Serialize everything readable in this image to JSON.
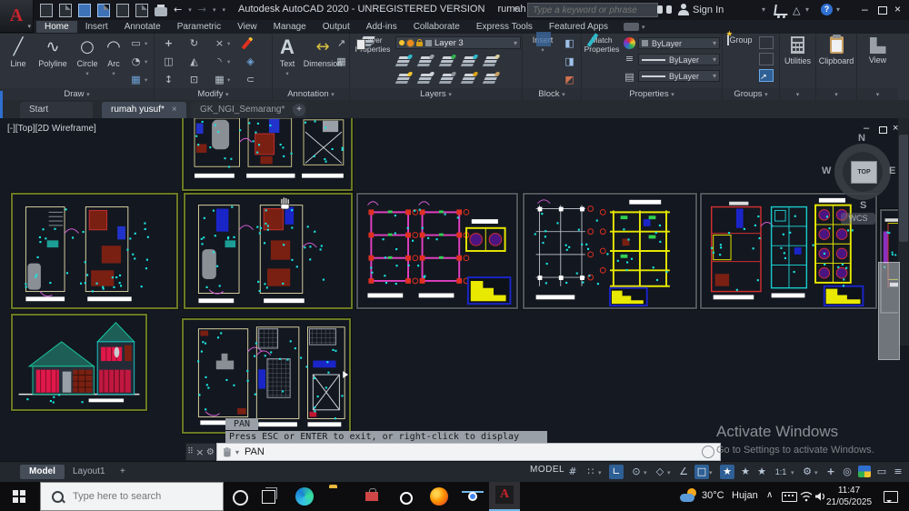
{
  "titlebar": {
    "app_title": "Autodesk AutoCAD 2020 - UNREGISTERED VERSION",
    "doc_title": "rumah yusuf.dwg",
    "search_placeholder": "Type a keyword or phrase",
    "sign_in": "Sign In",
    "adsk_glyph": "△"
  },
  "ribbon": {
    "tabs": [
      "Home",
      "Insert",
      "Annotate",
      "Parametric",
      "View",
      "Manage",
      "Output",
      "Add-ins",
      "Collaborate",
      "Express Tools",
      "Featured Apps"
    ],
    "panels": {
      "draw": {
        "label": "Draw",
        "line": "Line",
        "polyline": "Polyline",
        "circle": "Circle",
        "arc": "Arc"
      },
      "modify": {
        "label": "Modify"
      },
      "annotation": {
        "label": "Annotation",
        "text": "Text",
        "dimension": "Dimension"
      },
      "layers": {
        "label": "Layers",
        "layer_properties": "Layer Properties",
        "current_layer": "Layer 3"
      },
      "block": {
        "label": "Block",
        "insert": "Insert"
      },
      "properties": {
        "label": "Properties",
        "match_properties": "Match Properties",
        "color": "ByLayer",
        "lineweight": "ByLayer",
        "linetype": "ByLayer"
      },
      "groups": {
        "label": "Groups",
        "group": "Group"
      },
      "utilities": {
        "label": "Utilities"
      },
      "clipboard": {
        "label": "Clipboard"
      },
      "view": {
        "label": "View"
      }
    }
  },
  "file_tabs": {
    "start": "Start",
    "tab1": "rumah yusuf*",
    "tab2": "GK_NGI_Semarang*",
    "close": "×",
    "add": "+"
  },
  "canvas": {
    "viewport_label": "[-][Top][2D Wireframe]",
    "viewcube": {
      "n": "N",
      "s": "S",
      "e": "E",
      "w": "W",
      "top": "TOP",
      "wcs": "WCS"
    },
    "pan_tooltip": "PAN",
    "prompt": "Press ESC or ENTER to exit, or right-click to display shortcut menu.",
    "command": "PAN",
    "watermark": {
      "line1": "Activate Windows",
      "line2": "Go to Settings to activate Windows."
    }
  },
  "statusbar": {
    "model_tab": "Model",
    "layout_tab": "Layout1",
    "add_layout": "+",
    "model_badge": "MODEL",
    "annotation_scale": "1:1"
  },
  "taskbar": {
    "search_placeholder": "Type here to search",
    "autocad_letter": "A",
    "weather_temp": "30°C",
    "weather_desc": "Hujan",
    "time": "11:47",
    "date": "21/05/2025"
  },
  "icons": {
    "dropdown": "▾",
    "flyout": "▸",
    "minimize": "–",
    "close": "×",
    "undo": "←",
    "redo": "→",
    "line": "╱",
    "polyline": "∿",
    "circle": "○",
    "arc": "◠",
    "rectangle": "▭",
    "ellipse": "◔",
    "hatch": "▦",
    "move": "+",
    "rotate": "↻",
    "trim": "×",
    "copy": "◫",
    "mirror": "◭",
    "fillet": "◝",
    "explode": "◈",
    "stretch": "↕",
    "scale": "⊡",
    "array": "▦",
    "offset": "⊂",
    "text_glyph": "A",
    "dimension": "↔",
    "leader": "↗",
    "table": "▦",
    "lines3": "≡",
    "hatchrow": "▤",
    "grip": "⠿",
    "wrench": "⚙",
    "grid": "#",
    "snap": "∷",
    "ortho": "∟",
    "polar": "⊙",
    "isodraft": "◇",
    "otrack": "∠",
    "osnap": "□",
    "annot": "★",
    "gear": "⚙",
    "plus": "+",
    "isolate": "◎",
    "clean": "▭",
    "burger": "≡",
    "caret_up": "∧",
    "arrow_sel": "→"
  },
  "colors": {
    "accent_blue": "#2f6fd0",
    "toggle_on": "#2e5f95",
    "cad_cyan": "#19e5e0",
    "cad_magenta": "#d65fd6",
    "cad_red": "#e03020",
    "cad_yellow": "#e8e800",
    "frame_olive": "#6b7a24",
    "frame_gray": "#50555d"
  }
}
